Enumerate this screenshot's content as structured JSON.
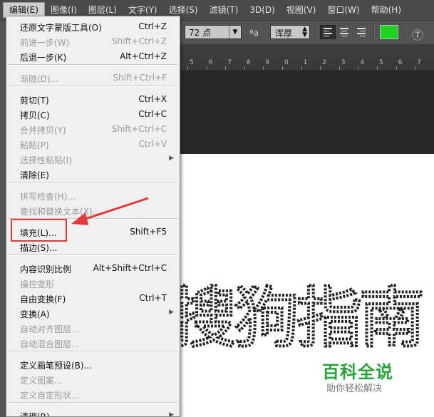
{
  "menubar": {
    "items": [
      "编辑(E)",
      "图像(I)",
      "图层(L)",
      "文字(Y)",
      "选择(S)",
      "滤镜(T)",
      "3D(D)",
      "视图(V)",
      "窗口(W)",
      "帮助(H)"
    ]
  },
  "options": {
    "font_size": "72 点",
    "aa_icon": "ªa",
    "aa_mode": "浑厚",
    "text_color": "#22dd22"
  },
  "ruler": {
    "ticks": [
      "5",
      "6",
      "7",
      "8",
      "9",
      "0",
      "1",
      "2",
      "3",
      "4",
      "5",
      "6",
      "7"
    ]
  },
  "menu": {
    "items": [
      {
        "label": "还原文字蒙版工具(O)",
        "shortcut": "Ctrl+Z",
        "disabled": false
      },
      {
        "label": "前进一步(W)",
        "shortcut": "Shift+Ctrl+Z",
        "disabled": true
      },
      {
        "label": "后退一步(K)",
        "shortcut": "Alt+Ctrl+Z",
        "disabled": false
      },
      {
        "label": "渐隐(D)...",
        "shortcut": "Shift+Ctrl+F",
        "disabled": true
      },
      {
        "label": "剪切(T)",
        "shortcut": "Ctrl+X",
        "disabled": false
      },
      {
        "label": "拷贝(C)",
        "shortcut": "Ctrl+C",
        "disabled": false
      },
      {
        "label": "合并拷贝(Y)",
        "shortcut": "Shift+Ctrl+C",
        "disabled": true
      },
      {
        "label": "粘贴(P)",
        "shortcut": "Ctrl+V",
        "disabled": true
      },
      {
        "label": "选择性粘贴(I)",
        "shortcut": "",
        "disabled": true,
        "submenu": true
      },
      {
        "label": "清除(E)",
        "shortcut": "",
        "disabled": false
      },
      {
        "label": "拼写检查(H)...",
        "shortcut": "",
        "disabled": true
      },
      {
        "label": "查找和替换文本(X)...",
        "shortcut": "",
        "disabled": true
      },
      {
        "label": "填充(L)...",
        "shortcut": "Shift+F5",
        "disabled": false
      },
      {
        "label": "描边(S)...",
        "shortcut": "",
        "disabled": false
      },
      {
        "label": "内容识别比例",
        "shortcut": "Alt+Shift+Ctrl+C",
        "disabled": false
      },
      {
        "label": "操控变形",
        "shortcut": "",
        "disabled": true
      },
      {
        "label": "自由变换(F)",
        "shortcut": "Ctrl+T",
        "disabled": false
      },
      {
        "label": "变换(A)",
        "shortcut": "",
        "disabled": false,
        "submenu": true
      },
      {
        "label": "自动对齐图层...",
        "shortcut": "",
        "disabled": true
      },
      {
        "label": "自动混合图层...",
        "shortcut": "",
        "disabled": true
      },
      {
        "label": "定义画笔预设(B)...",
        "shortcut": "",
        "disabled": false
      },
      {
        "label": "定义图案...",
        "shortcut": "",
        "disabled": true
      },
      {
        "label": "定义自定形状...",
        "shortcut": "",
        "disabled": true
      },
      {
        "label": "清理(R)",
        "shortcut": "",
        "disabled": false,
        "submenu": true
      }
    ]
  },
  "canvas": {
    "selection_text": "搜狗指南",
    "watermark_title": "百科全说",
    "watermark_sub": "助你轻松解决"
  },
  "colors": {
    "highlight": "#e23a3a",
    "watermark": "#27a33b"
  }
}
